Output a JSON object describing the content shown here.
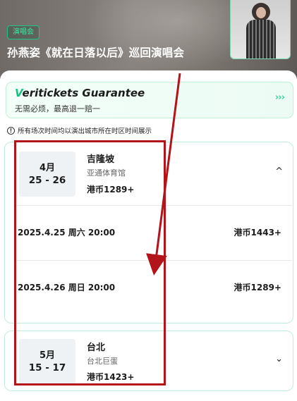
{
  "header": {
    "tag": "演唱会",
    "title": "孙燕姿《就在日落以后》巡回演唱会"
  },
  "guarantee": {
    "brand_v": "V",
    "brand_rest": "eritickets Guarantee",
    "subtitle": "无需必烦，最高退一赔一",
    "arrows": "›››"
  },
  "notice": {
    "icon": "info-icon",
    "text": "所有场次时间均以演出城市所在时区时间展示"
  },
  "events": [
    {
      "month": "4月",
      "days": "25 - 26",
      "city": "吉隆坡",
      "venue": "亚通体育馆",
      "price_from": "港币1289+",
      "expanded": true,
      "chevron": "^",
      "sessions": [
        {
          "datetime": "2025.4.25 周六 20:00",
          "price": "港币1443+"
        },
        {
          "datetime": "2025.4.26 周日 20:00",
          "price": "港币1289+"
        }
      ]
    },
    {
      "month": "5月",
      "days": "15 - 17",
      "city": "台北",
      "venue": "台北巨蛋",
      "price_from": "港币1423+",
      "expanded": false,
      "chevron": "⌄"
    }
  ],
  "colors": {
    "accent_green": "#14c47e",
    "annotation_red": "#b3141a"
  }
}
